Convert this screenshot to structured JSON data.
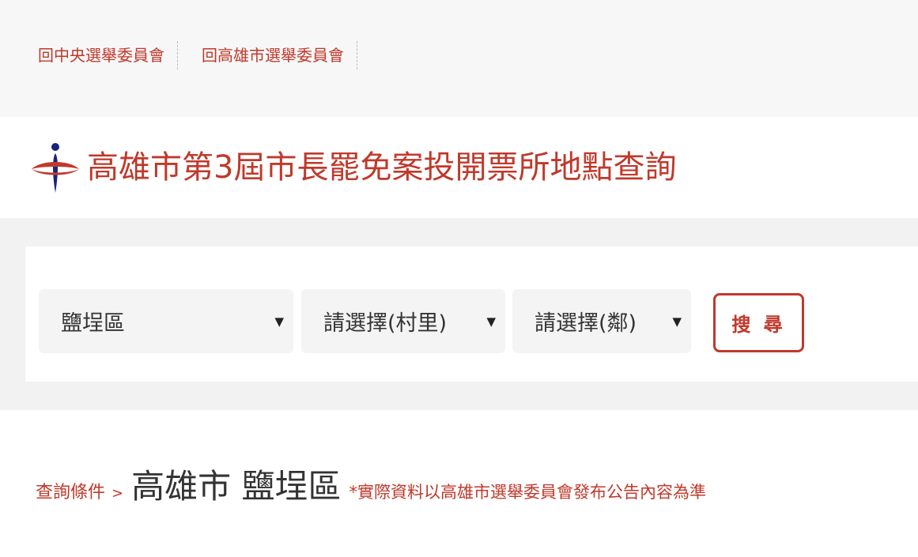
{
  "top_links": [
    "回中央選舉委員會",
    "回高雄市選舉委員會"
  ],
  "title": "高雄市第3屆市長罷免案投開票所地點查詢",
  "search": {
    "district": "鹽埕區",
    "village": "請選擇(村里)",
    "neighborhood": "請選擇(鄰)",
    "button": "搜 尋",
    "arrow": "▼"
  },
  "condition": {
    "label": "查詢條件",
    "separator": ">",
    "value": "高雄市 鹽埕區",
    "note": "*實際資料以高雄市選舉委員會發布公告內容為準"
  },
  "colors": {
    "accent": "#c0392b",
    "logo_blue": "#1a237e"
  },
  "icons": {
    "logo": "cec-logo-icon",
    "dropdown": "chevron-down-icon"
  }
}
